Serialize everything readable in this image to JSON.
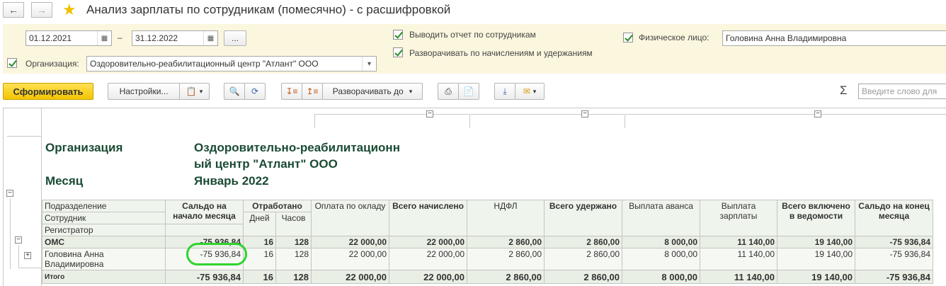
{
  "window": {
    "title": "Анализ зарплаты по сотрудникам (помесячно) - с расшифровкой"
  },
  "nav": {
    "back_icon": "arrow-left-icon",
    "forward_icon": "arrow-right-icon",
    "favorite_icon": "star-icon"
  },
  "settings": {
    "date_from": "01.12.2021",
    "date_sep": "–",
    "date_to": "31.12.2022",
    "period_btn": "...",
    "show_by_employees": "Выводить отчет по сотрудникам",
    "expand_accruals": "Разворачивать по начислениям и удержаниям",
    "person_label": "Физическое лицо:",
    "person_value": "Головина Анна Владимировна",
    "org_label": "Организация:",
    "org_value": "Оздоровительно-реабилитационный центр \"Атлант\" ООО"
  },
  "toolbar": {
    "generate": "Сформировать",
    "settings": "Настройки...",
    "expand_to": "Разворачивать до",
    "sum_symbol": "Σ",
    "search_placeholder": "Введите слово для"
  },
  "report": {
    "org_label": "Организация",
    "org_value_line1": "Оздоровительно-реабилитационн",
    "org_value_line2": "ый центр \"Атлант\" ООО",
    "month_label": "Месяц",
    "month_value": "Январь 2022",
    "columns": {
      "row_header_1": "Подразделение",
      "row_header_2": "Сотрудник",
      "row_header_3": "Регистратор",
      "opening_balance": "Сальдо на начало месяца",
      "worked": "Отработано",
      "days": "Дней",
      "hours": "Часов",
      "salary_pay": "Оплата по окладу",
      "total_accrued": "Всего начислено",
      "ndfl": "НДФЛ",
      "total_withheld": "Всего удержано",
      "advance_payment": "Выплата аванса",
      "salary_payment": "Выплата зарплаты",
      "total_in_statement": "Всего включено в ведомости",
      "closing_balance": "Сальдо на конец месяца"
    },
    "rows": [
      {
        "name": "ОМС",
        "values": [
          "-75 936,84",
          "16",
          "128",
          "22 000,00",
          "22 000,00",
          "2 860,00",
          "2 860,00",
          "8 000,00",
          "11 140,00",
          "19 140,00",
          "-75 936,84"
        ]
      },
      {
        "name": "Головина Анна Владимировна",
        "values": [
          "-75 936,84",
          "16",
          "128",
          "22 000,00",
          "22 000,00",
          "2 860,00",
          "2 860,00",
          "8 000,00",
          "11 140,00",
          "19 140,00",
          "-75 936,84"
        ]
      }
    ],
    "total": {
      "name": "Итого",
      "values": [
        "-75 936,84",
        "16",
        "128",
        "22 000,00",
        "22 000,00",
        "2 860,00",
        "2 860,00",
        "8 000,00",
        "11 140,00",
        "19 140,00",
        "-75 936,84"
      ]
    },
    "collapse_symbol": "−",
    "expand_symbol": "+"
  },
  "colors": {
    "accent_yellow": "#f3c500",
    "highlight_green": "#2ed42e",
    "header_text": "#1a4b33"
  }
}
